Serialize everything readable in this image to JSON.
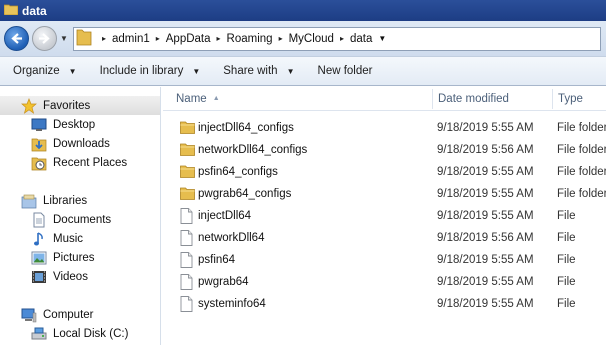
{
  "window": {
    "title": "data"
  },
  "address": {
    "crumbs": [
      "admin1",
      "AppData",
      "Roaming",
      "MyCloud",
      "data"
    ]
  },
  "toolbar": {
    "organize": "Organize",
    "include": "Include in library",
    "share": "Share with",
    "newfolder": "New folder"
  },
  "nav": {
    "favorites": "Favorites",
    "desktop": "Desktop",
    "downloads": "Downloads",
    "recent": "Recent Places",
    "libraries": "Libraries",
    "documents": "Documents",
    "music": "Music",
    "pictures": "Pictures",
    "videos": "Videos",
    "computer": "Computer",
    "localdisk": "Local Disk (C:)"
  },
  "columns": {
    "name": "Name",
    "date": "Date modified",
    "type": "Type"
  },
  "files": [
    {
      "name": "injectDll64_configs",
      "date": "9/18/2019 5:55 AM",
      "type": "File folder",
      "kind": "folder-icon"
    },
    {
      "name": "networkDll64_configs",
      "date": "9/18/2019 5:56 AM",
      "type": "File folder",
      "kind": "folder-icon"
    },
    {
      "name": "psfin64_configs",
      "date": "9/18/2019 5:55 AM",
      "type": "File folder",
      "kind": "folder-icon"
    },
    {
      "name": "pwgrab64_configs",
      "date": "9/18/2019 5:55 AM",
      "type": "File folder",
      "kind": "folder-icon"
    },
    {
      "name": "injectDll64",
      "date": "9/18/2019 5:55 AM",
      "type": "File",
      "kind": "file-icon"
    },
    {
      "name": "networkDll64",
      "date": "9/18/2019 5:56 AM",
      "type": "File",
      "kind": "file-icon"
    },
    {
      "name": "psfin64",
      "date": "9/18/2019 5:55 AM",
      "type": "File",
      "kind": "file-icon"
    },
    {
      "name": "pwgrab64",
      "date": "9/18/2019 5:55 AM",
      "type": "File",
      "kind": "file-icon"
    },
    {
      "name": "systeminfo64",
      "date": "9/18/2019 5:55 AM",
      "type": "File",
      "kind": "file-icon"
    }
  ]
}
